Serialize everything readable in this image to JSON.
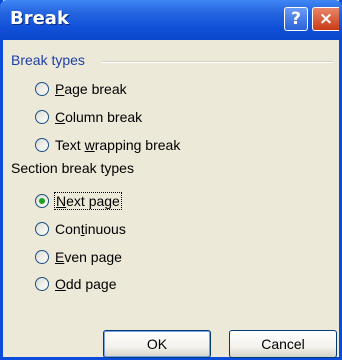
{
  "window": {
    "title": "Break",
    "help_symbol": "?",
    "close_symbol": "×"
  },
  "break_types": {
    "heading": "Break types",
    "options": [
      {
        "pre": "",
        "mnemonic": "P",
        "post": "age break",
        "checked": false
      },
      {
        "pre": "",
        "mnemonic": "C",
        "post": "olumn break",
        "checked": false
      },
      {
        "pre": "Text ",
        "mnemonic": "w",
        "post": "rapping break",
        "checked": false
      }
    ]
  },
  "section_break_types": {
    "heading": "Section break types",
    "options": [
      {
        "pre": "",
        "mnemonic": "N",
        "post": "ext page",
        "checked": true
      },
      {
        "pre": "Con",
        "mnemonic": "t",
        "post": "inuous",
        "checked": false
      },
      {
        "pre": "",
        "mnemonic": "E",
        "post": "ven page",
        "checked": false
      },
      {
        "pre": "",
        "mnemonic": "O",
        "post": "dd page",
        "checked": false
      }
    ]
  },
  "buttons": {
    "ok": "OK",
    "cancel": "Cancel"
  }
}
